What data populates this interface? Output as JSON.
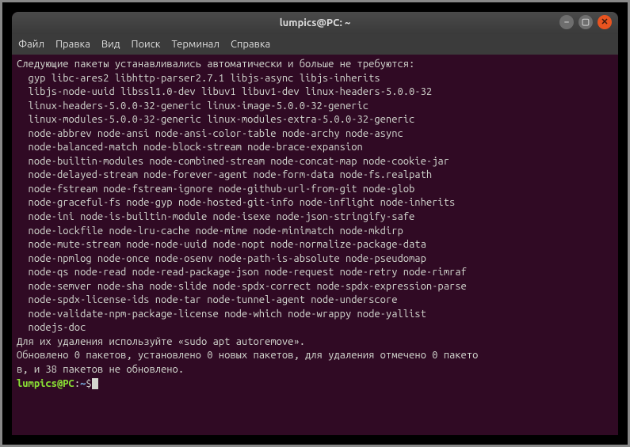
{
  "window": {
    "title": "lumpics@PC: ~"
  },
  "menu": {
    "file": "Файл",
    "edit": "Правка",
    "view": "Вид",
    "search": "Поиск",
    "terminal": "Терминал",
    "help": "Справка"
  },
  "output": {
    "header": "Следующие пакеты устанавливались автоматически и больше не требуются:",
    "lines": [
      "gyp libc-ares2 libhttp-parser2.7.1 libjs-async libjs-inherits",
      "libjs-node-uuid libssl1.0-dev libuv1 libuv1-dev linux-headers-5.0.0-32",
      "linux-headers-5.0.0-32-generic linux-image-5.0.0-32-generic",
      "linux-modules-5.0.0-32-generic linux-modules-extra-5.0.0-32-generic",
      "node-abbrev node-ansi node-ansi-color-table node-archy node-async",
      "node-balanced-match node-block-stream node-brace-expansion",
      "node-builtin-modules node-combined-stream node-concat-map node-cookie-jar",
      "node-delayed-stream node-forever-agent node-form-data node-fs.realpath",
      "node-fstream node-fstream-ignore node-github-url-from-git node-glob",
      "node-graceful-fs node-gyp node-hosted-git-info node-inflight node-inherits",
      "node-ini node-is-builtin-module node-isexe node-json-stringify-safe",
      "node-lockfile node-lru-cache node-mime node-minimatch node-mkdirp",
      "node-mute-stream node-node-uuid node-nopt node-normalize-package-data",
      "node-npmlog node-once node-osenv node-path-is-absolute node-pseudomap",
      "node-qs node-read node-read-package-json node-request node-retry node-rimraf",
      "node-semver node-sha node-slide node-spdx-correct node-spdx-expression-parse",
      "node-spdx-license-ids node-tar node-tunnel-agent node-underscore",
      "node-validate-npm-package-license node-which node-wrappy node-yallist",
      "nodejs-doc"
    ],
    "autoremove": "Для их удаления используйте «sudo apt autoremove».",
    "summary1": "Обновлено 0 пакетов, установлено 0 новых пакетов, для удаления отмечено 0 пакето",
    "summary2": "в, и 38 пакетов не обновлено."
  },
  "prompt": {
    "userhost": "lumpics@PC",
    "colon": ":",
    "path": "~",
    "dollar": "$"
  }
}
